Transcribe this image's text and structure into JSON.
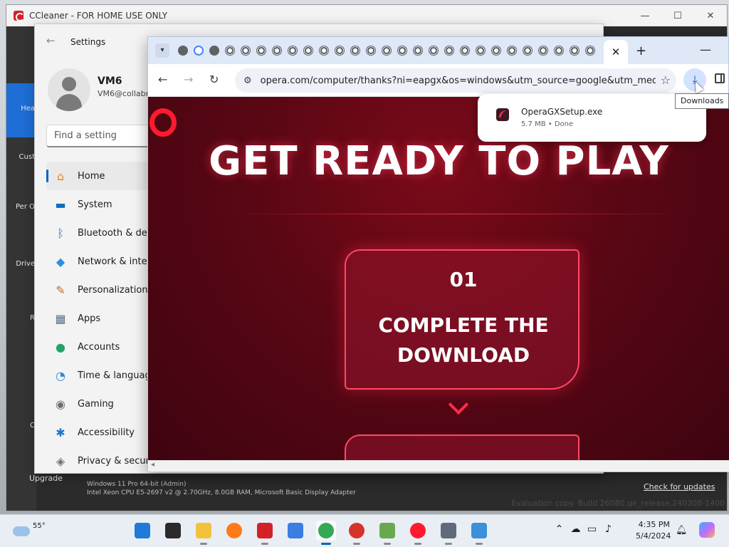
{
  "ccleaner": {
    "title": "CCleaner - FOR HOME USE ONLY",
    "controls": {
      "minimize": "—",
      "maximize": "☐",
      "close": "✕"
    },
    "sidebar": [
      "Hea",
      "Cust",
      "Per O",
      "Drive",
      "R",
      "C"
    ],
    "upgrade": "Upgrade",
    "sysinfo_line1": "Windows 11 Pro 64-bit (Admin)",
    "sysinfo_line2": "Intel Xeon CPU E5-2697 v2 @ 2.70GHz, 8.0GB RAM, Microsoft Basic Display Adapter",
    "check_updates": "Check for updates",
    "evaluation": "Evaluation copy. Build 26080.ge_release.240308-1400"
  },
  "settings": {
    "title": "Settings",
    "back": "←",
    "user": {
      "name": "VM6",
      "email": "VM6@collabr"
    },
    "search_placeholder": "Find a setting",
    "nav": [
      {
        "label": "Home",
        "icon": "⌂",
        "color": "#e8872c"
      },
      {
        "label": "System",
        "icon": "▬",
        "color": "#0a6fc2"
      },
      {
        "label": "Bluetooth & dev",
        "icon": "ᛒ",
        "color": "#1a83d6"
      },
      {
        "label": "Network & inter",
        "icon": "◆",
        "color": "#2a8ee0"
      },
      {
        "label": "Personalization",
        "icon": "✎",
        "color": "#c06a2a"
      },
      {
        "label": "Apps",
        "icon": "▦",
        "color": "#5a6f8f"
      },
      {
        "label": "Accounts",
        "icon": "●",
        "color": "#23a36b"
      },
      {
        "label": "Time & languag",
        "icon": "◔",
        "color": "#2f86d6"
      },
      {
        "label": "Gaming",
        "icon": "◉",
        "color": "#6d6d6d"
      },
      {
        "label": "Accessibility",
        "icon": "✱",
        "color": "#1d79c9"
      },
      {
        "label": "Privacy & securi",
        "icon": "◈",
        "color": "#6b6f78"
      }
    ]
  },
  "chrome": {
    "url": "opera.com/computer/thanks?ni=eapgx&os=windows&utm_source=google&utm_med...",
    "active_tab_close": "✕",
    "new_tab": "+",
    "minimize": "—",
    "tooltip": "Downloads",
    "download": {
      "filename": "OperaGXSetup.exe",
      "status": "5.7 MB • Done"
    }
  },
  "page": {
    "headline": "GET READY TO PLAY",
    "step_number": "01",
    "step_line1": "COMPLETE THE",
    "step_line2": "DOWNLOAD"
  },
  "taskbar": {
    "temperature": "55°",
    "time": "4:35 PM",
    "date": "5/4/2024",
    "apps": [
      {
        "name": "start",
        "color": "#1f7ad8"
      },
      {
        "name": "search",
        "color": "#2b2b2b"
      },
      {
        "name": "file-explorer",
        "color": "#f3c13a"
      },
      {
        "name": "firefox",
        "color": "#ff7a18"
      },
      {
        "name": "ccleaner",
        "color": "#d42027"
      },
      {
        "name": "app-blue",
        "color": "#3b7de0"
      },
      {
        "name": "chrome",
        "color": "#34a853"
      },
      {
        "name": "app-red",
        "color": "#d6332a"
      },
      {
        "name": "app-green",
        "color": "#6aa84f"
      },
      {
        "name": "opera",
        "color": "#ff1b2d"
      },
      {
        "name": "settings",
        "color": "#5f6b7a"
      },
      {
        "name": "app-monitor",
        "color": "#3c8fd8"
      }
    ]
  }
}
